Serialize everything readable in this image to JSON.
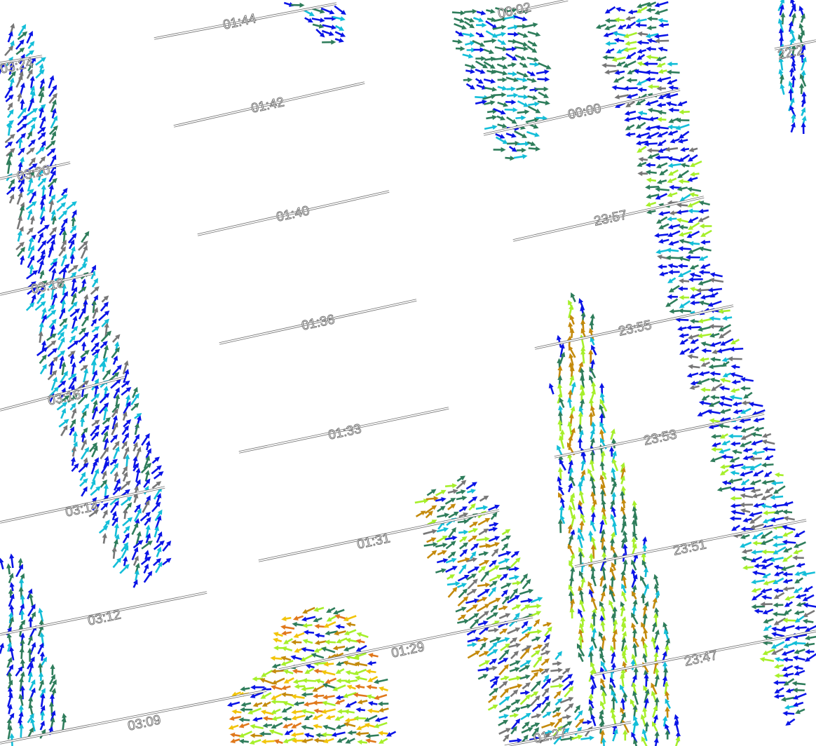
{
  "colors": {
    "blue": "#0a14e6",
    "cyan": "#14bed8",
    "teal_green": "#2e7d5b",
    "lime": "#a6ef2a",
    "amber": "#c48a0c",
    "gold": "#f2c40a",
    "orange": "#e0781c",
    "gray": "#777777"
  },
  "arrow_legend_note": "",
  "tracks": [
    {
      "time": "01:44"
    },
    {
      "time": "00:02"
    },
    {
      "time": "22:2"
    },
    {
      "time": "01:42"
    },
    {
      "time": "00:00"
    },
    {
      "time": "03:24"
    },
    {
      "time": "03:20"
    },
    {
      "time": "01:40"
    },
    {
      "time": "23:57"
    },
    {
      "time": "03:18"
    },
    {
      "time": "01:36"
    },
    {
      "time": "23:55"
    },
    {
      "time": "03:16"
    },
    {
      "time": "01:33"
    },
    {
      "time": "23:53"
    },
    {
      "time": "03:14"
    },
    {
      "time": "01:31"
    },
    {
      "time": "23:51"
    },
    {
      "time": "03:12"
    },
    {
      "time": "01:29"
    },
    {
      "time": "23:47"
    },
    {
      "time": "03:09"
    },
    {
      "time": "01:27"
    }
  ]
}
